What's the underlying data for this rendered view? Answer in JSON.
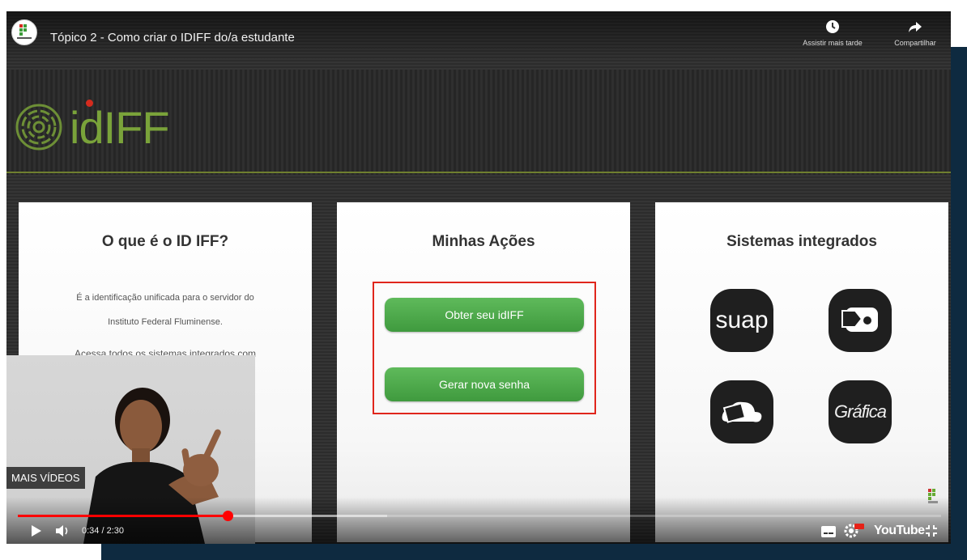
{
  "video": {
    "title": "Tópico 2 - Como criar o IDIFF do/a estudante",
    "channel_avatar": "instituto-federal-logo",
    "watch_later_label": "Assistir mais tarde",
    "share_label": "Compartilhar",
    "more_videos_label": "MAIS VÍDEOS",
    "time_display": "0:34 / 2:30",
    "progress_fraction": 0.227,
    "buffered_fraction": 0.4,
    "youtube_label": "YouTube"
  },
  "site": {
    "logo_text": "idIFF",
    "cards": [
      {
        "title": "O que é o ID IFF?",
        "lines": [
          "É a identificação unificada para o servidor do",
          "Instituto Federal Fluminense.",
          "Acessa todos os sistemas integrados com"
        ]
      },
      {
        "title": "Minhas Ações",
        "buttons": [
          "Obter seu idIFF",
          "Gerar nova senha"
        ]
      },
      {
        "title": "Sistemas integrados",
        "icons": [
          {
            "name": "suap",
            "label": "suap"
          },
          {
            "name": "email-tag-icon",
            "label": ""
          },
          {
            "name": "cloud-box-icon",
            "label": ""
          },
          {
            "name": "grafica",
            "label": "Gráfica"
          }
        ]
      }
    ]
  },
  "colors": {
    "accent_green": "#4caf50",
    "highlight_red": "#e0261c",
    "progress_red": "#ff0000",
    "frame_navy": "#0e2a40"
  }
}
